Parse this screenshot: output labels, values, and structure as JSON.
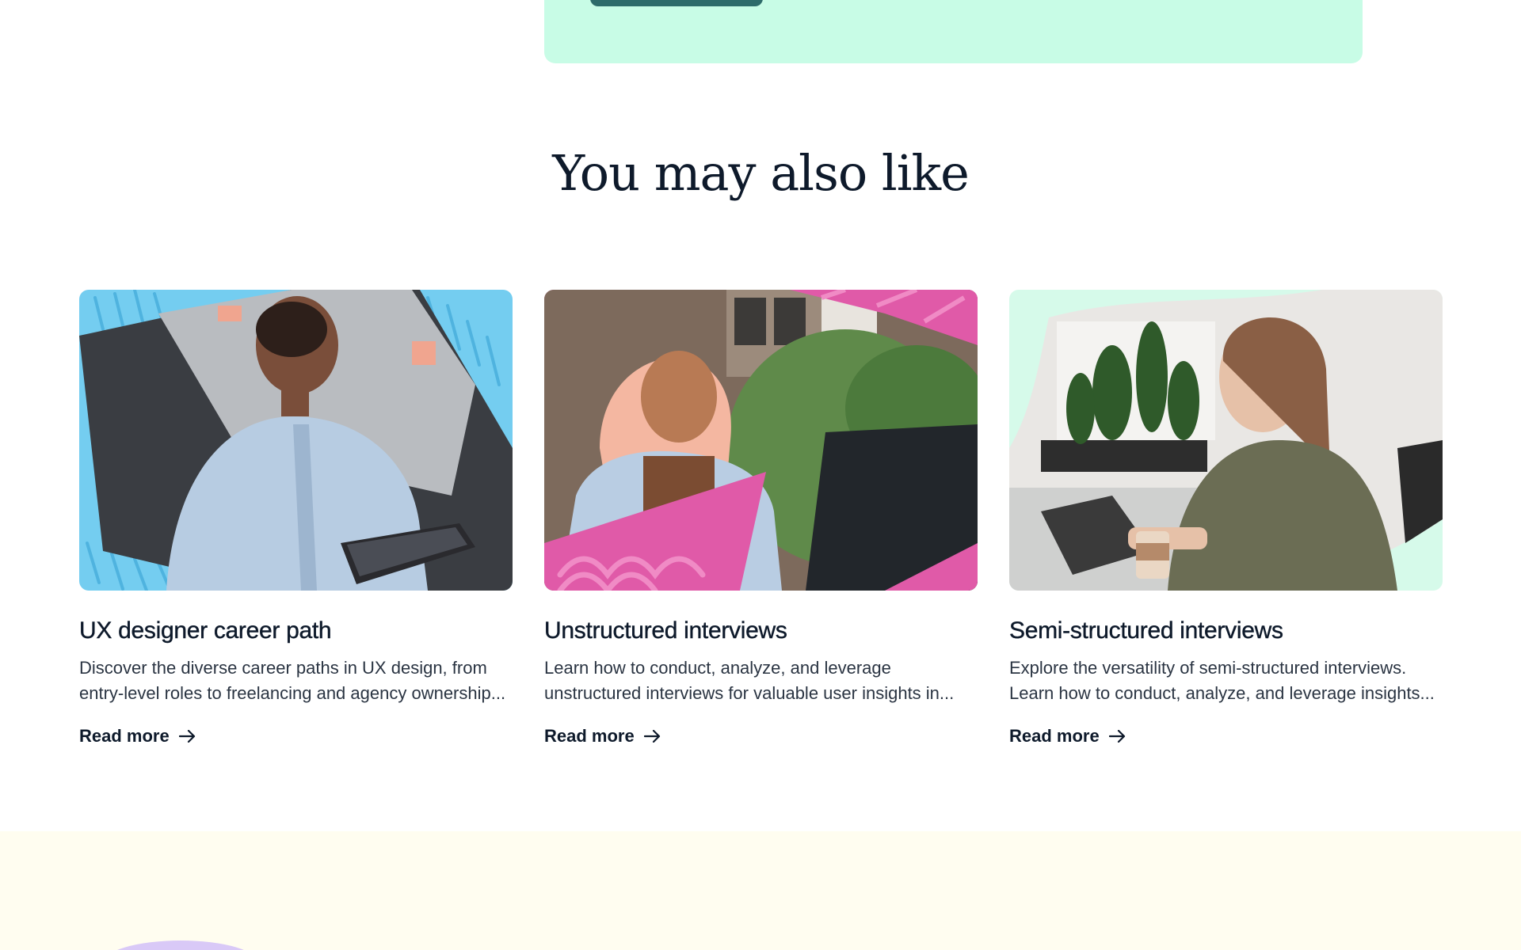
{
  "section": {
    "title": "You may also like"
  },
  "cards": [
    {
      "title": "UX designer career path",
      "excerpt": "Discover the diverse career paths in UX design, from entry-level roles to freelancing and agency ownership...",
      "link_label": "Read more",
      "image_accent": "#74cdf0"
    },
    {
      "title": "Unstructured interviews",
      "excerpt": "Learn how to conduct, analyze, and leverage unstructured interviews for valuable user insights in...",
      "link_label": "Read more",
      "image_accent": "#e05aa8"
    },
    {
      "title": "Semi-structured interviews",
      "excerpt": "Explore the versatility of semi-structured interviews. Learn how to conduct, analyze, and leverage insights...",
      "link_label": "Read more",
      "image_accent": "#d6faea"
    }
  ],
  "icons": {
    "read_more": "arrow-right-icon"
  },
  "colors": {
    "mint_card": "#c8fce6",
    "cta_button": "#2d6b6a",
    "footer_band": "#fffdf0",
    "text": "#0e1a2b"
  }
}
